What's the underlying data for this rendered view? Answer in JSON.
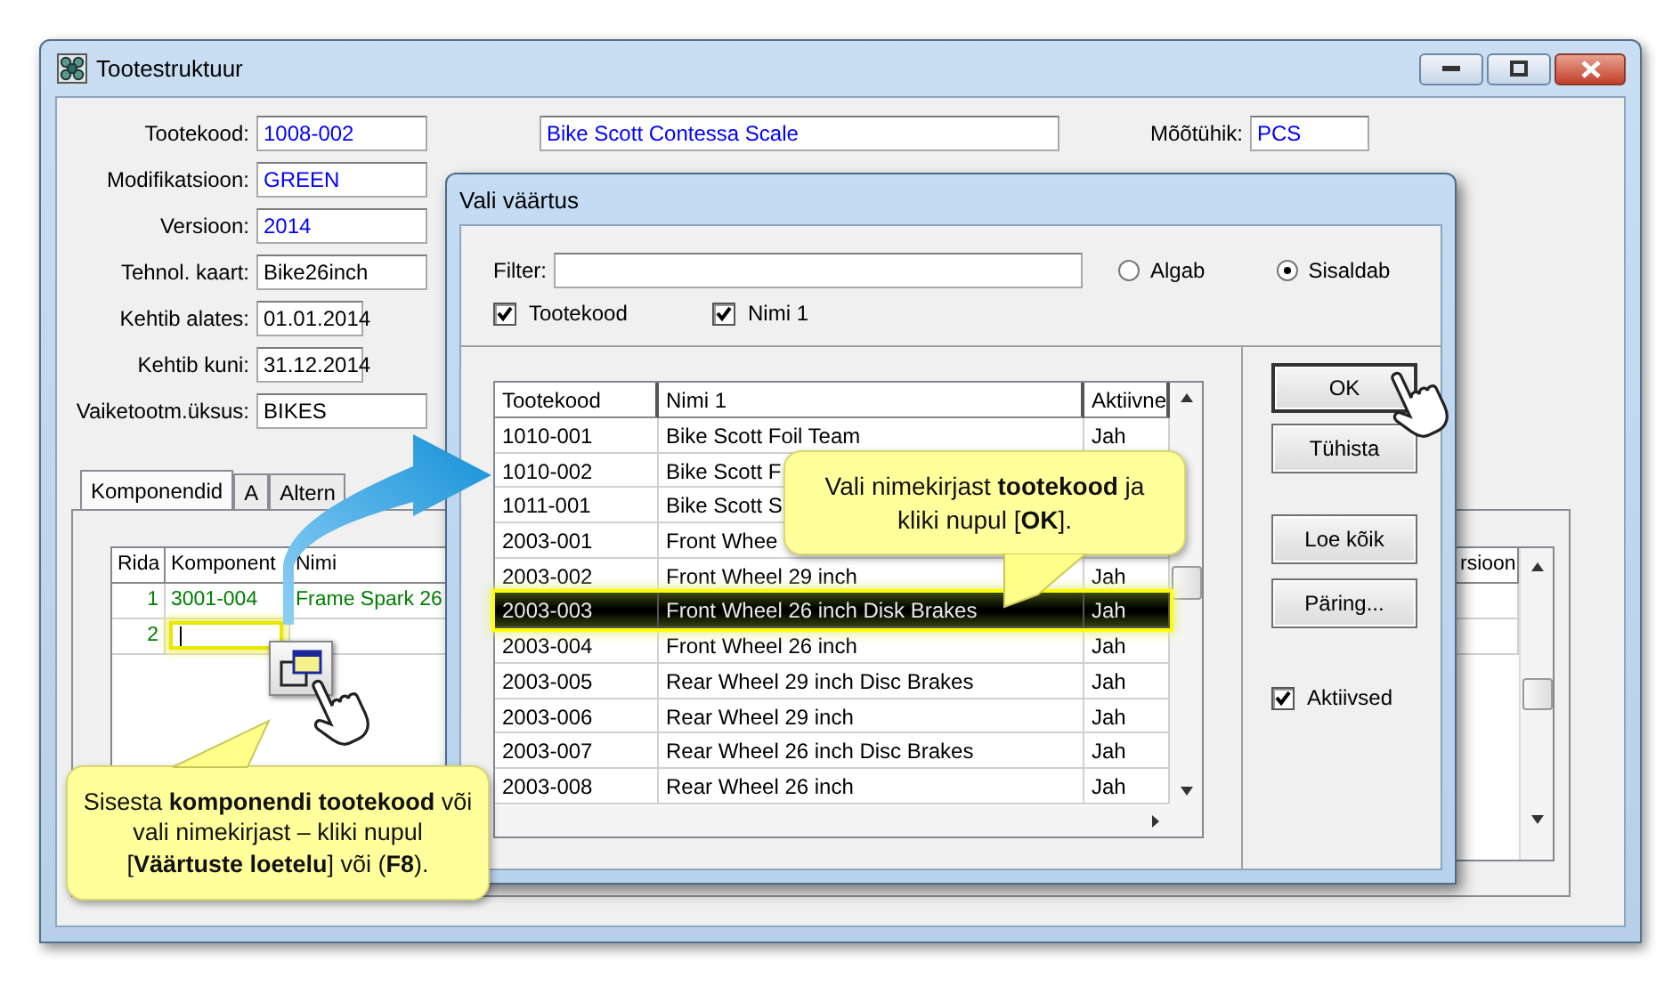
{
  "main_window": {
    "title": "Tootestruktuur",
    "fields": [
      {
        "label": "Tootekood:",
        "value": "1008-002",
        "kind": "text",
        "color": "#0000ff",
        "name": "Bike Scott Contessa Scale"
      },
      {
        "label": "Modifikatsioon:",
        "value": "GREEN",
        "kind": "text",
        "color": "#0000ff"
      },
      {
        "label": "Versioon:",
        "value": "2014",
        "kind": "text",
        "color": "#0000ff"
      },
      {
        "label": "Tehnol. kaart:",
        "value": "Bike26inch",
        "kind": "text",
        "color": "#000000"
      },
      {
        "label": "Kehtib alates:",
        "value": "01.01.2014",
        "kind": "date",
        "color": "#000000"
      },
      {
        "label": "Kehtib kuni:",
        "value": "31.12.2014",
        "kind": "date",
        "color": "#000000"
      },
      {
        "label": "Vaiketootm.üksus:",
        "value": "BIKES",
        "kind": "text",
        "color": "#000000"
      }
    ],
    "unit": {
      "label": "Mõõtühik:",
      "value": "PCS"
    },
    "tabs": [
      {
        "label": "Komponendid",
        "selected": true
      },
      {
        "label": "A",
        "selected": false
      },
      {
        "label": "Altern",
        "selected": false
      }
    ],
    "grid": {
      "columns": [
        "Rida",
        "Komponent",
        "Nimi"
      ],
      "column_4": "rsioon",
      "rows": [
        {
          "rida": "1",
          "komponent": "3001-004",
          "nimi": "Frame Spark 26",
          "editing": false
        },
        {
          "rida": "2",
          "editing": true
        }
      ]
    }
  },
  "dialog": {
    "title": "Vali väärtus",
    "filter_label": "Filter:",
    "match_options": [
      {
        "label": "Algab",
        "selected": false
      },
      {
        "label": "Sisaldab",
        "selected": true
      }
    ],
    "search_in": [
      {
        "label": "Tootekood",
        "checked": true
      },
      {
        "label": "Nimi 1",
        "checked": true
      }
    ],
    "columns": [
      "Tootekood",
      "Nimi 1",
      "Aktiivne"
    ],
    "rows": [
      {
        "code": "1010-001",
        "name": "Bike Scott Foil Team",
        "active": "Jah",
        "selected": false
      },
      {
        "code": "1010-002",
        "name": "Bike Scott F",
        "selected": false
      },
      {
        "code": "1011-001",
        "name": "Bike Scott S",
        "selected": false
      },
      {
        "code": "2003-001",
        "name": "Front Whee",
        "selected": false
      },
      {
        "code": "2003-002",
        "name": "Front Wheel 29 inch",
        "active": "Jah",
        "selected": false
      },
      {
        "code": "2003-003",
        "name": "Front Wheel 26 inch Disk Brakes",
        "active": "Jah",
        "selected": true
      },
      {
        "code": "2003-004",
        "name": "Front Wheel 26 inch",
        "active": "Jah",
        "selected": false
      },
      {
        "code": "2003-005",
        "name": "Rear Wheel 29 inch Disc Brakes",
        "active": "Jah",
        "selected": false
      },
      {
        "code": "2003-006",
        "name": "Rear Wheel 29 inch",
        "active": "Jah",
        "selected": false
      },
      {
        "code": "2003-007",
        "name": "Rear Wheel 26 inch Disc Brakes",
        "active": "Jah",
        "selected": false
      },
      {
        "code": "2003-008",
        "name": "Rear Wheel 26 inch",
        "active": "Jah",
        "selected": false
      }
    ],
    "buttons": [
      {
        "label": "OK",
        "kind": "action"
      },
      {
        "label": "Tühista",
        "kind": "action"
      },
      {
        "label": "Loe kõik",
        "kind": "tool"
      },
      {
        "label": "Päring...",
        "kind": "tool"
      }
    ],
    "active_only": {
      "label": "Aktiivsed",
      "checked": true
    }
  },
  "callouts": [
    {
      "kind": "list",
      "text": "Vali nimekirjast **tootekood** ja kliki nupul [**OK**]."
    },
    {
      "kind": "field",
      "text": "Sisesta **komponendi tootekood** või vali nimekirjast – kliki nupul [**Väärtuste loetelu**] või (**F8**)."
    }
  ]
}
